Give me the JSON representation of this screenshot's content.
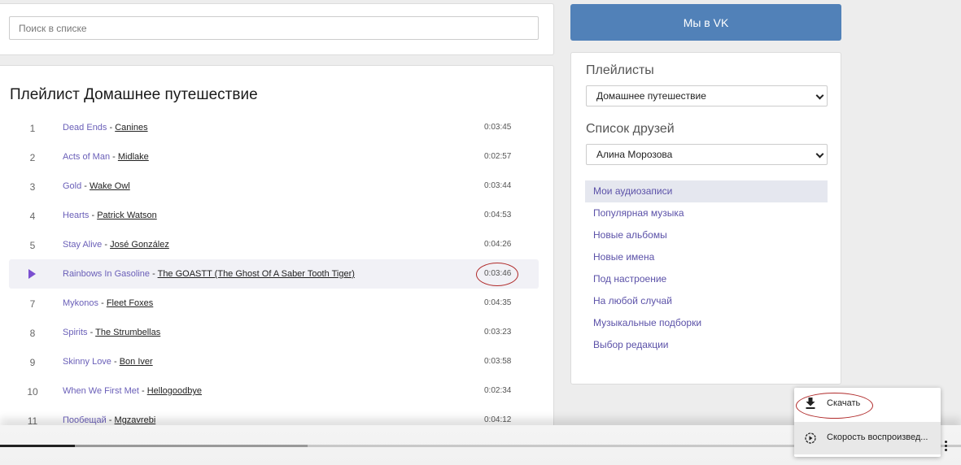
{
  "search": {
    "placeholder": "Поиск в списке"
  },
  "playlist": {
    "title": "Плейлист Домашнее путешествие",
    "separator": " - ",
    "tracks": [
      {
        "num": "1",
        "song": "Dead Ends",
        "artist": "Canines",
        "duration": "0:03:45"
      },
      {
        "num": "2",
        "song": "Acts of Man",
        "artist": "Midlake",
        "duration": "0:02:57"
      },
      {
        "num": "3",
        "song": "Gold",
        "artist": "Wake Owl",
        "duration": "0:03:44"
      },
      {
        "num": "4",
        "song": "Hearts",
        "artist": "Patrick Watson",
        "duration": "0:04:53"
      },
      {
        "num": "5",
        "song": "Stay Alive",
        "artist": "José González",
        "duration": "0:04:26"
      },
      {
        "num": "",
        "song": "Rainbows In Gasoline",
        "artist": "The GOASTT (The Ghost Of A Saber Tooth Tiger)",
        "duration": "0:03:46"
      },
      {
        "num": "7",
        "song": "Mykonos",
        "artist": "Fleet Foxes",
        "duration": "0:04:35"
      },
      {
        "num": "8",
        "song": "Spirits",
        "artist": "The Strumbellas",
        "duration": "0:03:23"
      },
      {
        "num": "9",
        "song": "Skinny Love",
        "artist": "Bon Iver",
        "duration": "0:03:58"
      },
      {
        "num": "10",
        "song": "When We First Met",
        "artist": "Hellogoodbye",
        "duration": "0:02:34"
      },
      {
        "num": "11",
        "song": "Пообещай",
        "artist": "Mgzavrebi",
        "duration": "0:04:12"
      }
    ]
  },
  "vk_button": {
    "label": "Мы в VK"
  },
  "sidebar": {
    "playlists_heading": "Плейлисты",
    "playlists_selected": "Домашнее путешествие",
    "friends_heading": "Список друзей",
    "friends_selected": "Алина Морозова",
    "nav": [
      "Мои аудиозаписи",
      "Популярная музыка",
      "Новые альбомы",
      "Новые имена",
      "Под настроение",
      "На любой случай",
      "Музыкальные подборки",
      "Выбор редакции"
    ]
  },
  "context_menu": {
    "download": "Скачать",
    "speed": "Скорость воспроизвед..."
  },
  "player": {
    "progress_fraction": 0.078,
    "buffered_fraction": 0.32
  },
  "colors": {
    "accent": "#5181b8",
    "link": "#6a5fb8",
    "highlight": "#b02a2a"
  }
}
